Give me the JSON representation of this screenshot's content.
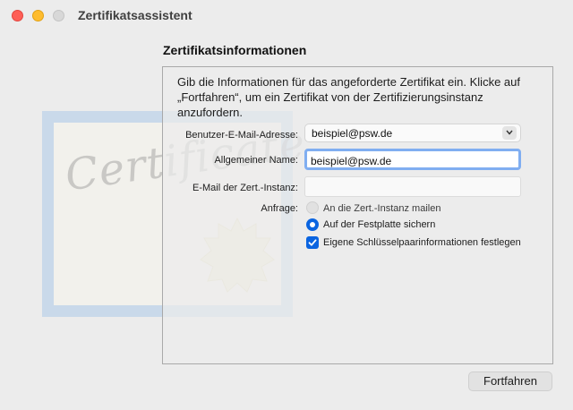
{
  "window": {
    "title": "Zertifikatsassistent"
  },
  "section": {
    "title": "Zertifikatsinformationen",
    "intro": "Gib die Informationen für das angeforderte Zertifikat ein. Klicke auf „Fortfahren“, um ein Zertifikat von der Zertifizierungsinstanz anzufordern."
  },
  "form": {
    "email_label": "Benutzer-E-Mail-Adresse:",
    "email_value": "beispiel@psw.de",
    "common_name_label": "Allgemeiner Name:",
    "common_name_value": "beispiel@psw.de",
    "ca_email_label": "E-Mail der Zert.-Instanz:",
    "ca_email_value": "",
    "request_label": "Anfrage:",
    "options": [
      {
        "label": "An die Zert.-Instanz mailen",
        "selected": false,
        "enabled": false
      },
      {
        "label": "Auf der Festplatte sichern",
        "selected": true,
        "enabled": true
      }
    ],
    "keypair_label": "Eigene Schlüsselpaarinformationen festlegen",
    "keypair_checked": true
  },
  "illustration": {
    "script_text": "Certificate"
  },
  "buttons": {
    "continue_label": "Fortfahren"
  },
  "colors": {
    "accent": "#0a64e0",
    "focus_ring": "#80aef1",
    "close": "#fe5f57",
    "minimize": "#febc2e"
  }
}
